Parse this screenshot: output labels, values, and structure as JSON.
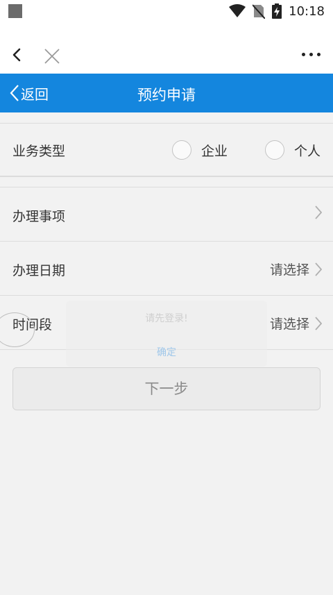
{
  "status_bar": {
    "time": "10:18"
  },
  "header": {
    "back_label": "返回",
    "title": "预约申请"
  },
  "business_type": {
    "label": "业务类型",
    "options": [
      {
        "label": "企业",
        "selected": false
      },
      {
        "label": "个人",
        "selected": false
      }
    ]
  },
  "rows": [
    {
      "label": "办理事项",
      "value": ""
    },
    {
      "label": "办理日期",
      "value": "请选择"
    },
    {
      "label": "时间段",
      "value": "请选择"
    }
  ],
  "dialog": {
    "message": "请先登录!",
    "confirm_label": "确定"
  },
  "next_button": {
    "label": "下一步"
  },
  "colors": {
    "header_bg": "#1486de",
    "background": "#f2f2f2"
  }
}
